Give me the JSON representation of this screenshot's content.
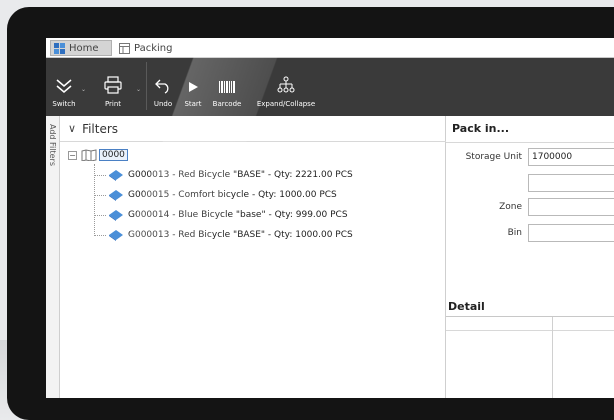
{
  "tabs": [
    {
      "label": "Home",
      "active": true
    },
    {
      "label": "Packing",
      "active": false
    }
  ],
  "ribbon": {
    "switch_label": "Switch",
    "print_label": "Print",
    "undo_label": "Undo",
    "start_label": "Start",
    "barcode_label": "Barcode",
    "expand_label": "Expand/Collapse"
  },
  "sidepanel": {
    "label": "Add Filters"
  },
  "filters": {
    "title": "Filters",
    "root": "0000",
    "items": [
      "G000013 - Red Bicycle \"BASE\" - Qty: 2221.00 PCS",
      "G000015 - Comfort bicycle - Qty: 1000.00 PCS",
      "G000014 - Blue Bicycle \"base\" - Qty: 999.00 PCS",
      "G000013 - Red Bicycle \"BASE\" - Qty: 1000.00 PCS"
    ]
  },
  "pack": {
    "title": "Pack in...",
    "storage_unit_label": "Storage Unit",
    "storage_unit_value": "1700000",
    "zone_label": "Zone",
    "bin_label": "Bin"
  },
  "detail": {
    "title": "Detail"
  },
  "colors": {
    "ribbon_bg": "#3a3a3a",
    "bezel": "#141414",
    "item_icon": "#4a8fd8",
    "selection_border": "#4a80c4"
  }
}
